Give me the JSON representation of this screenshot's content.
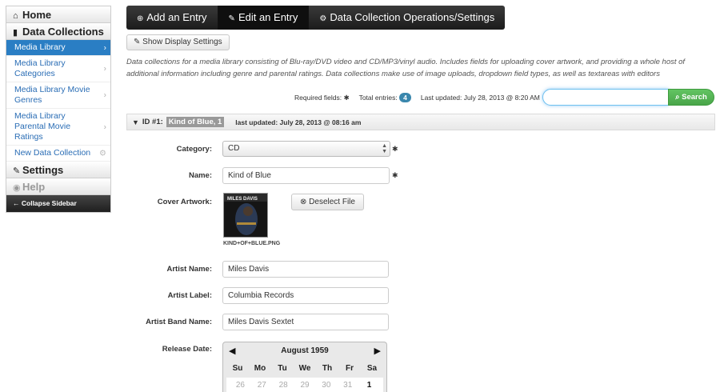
{
  "sidebar": {
    "home": "Home",
    "collections_header": "Data Collections",
    "items": [
      {
        "label": "Media Library"
      },
      {
        "label": "Media Library Categories"
      },
      {
        "label": "Media Library Movie Genres"
      },
      {
        "label": "Media Library Parental Movie Ratings"
      },
      {
        "label": "New Data Collection"
      }
    ],
    "settings": "Settings",
    "help": "Help",
    "collapse": "Collapse Sidebar"
  },
  "topnav": {
    "tabs": [
      {
        "label": "Add an Entry"
      },
      {
        "label": "Edit an Entry"
      },
      {
        "label": "Data Collection Operations/Settings"
      }
    ]
  },
  "toolbar": {
    "show_display": "Show Display Settings"
  },
  "description": "Data collections for a media library consisting of Blu-ray/DVD video and CD/MP3/vinyl audio. Includes fields for uploading cover artwork, and providing a whole host of additional information including genre and parental ratings. Data collections make use of image uploads, dropdown field types, as well as textareas with editors",
  "status": {
    "required_label": "Required fields:",
    "required_mark": "✱",
    "total_label": "Total entries:",
    "total_value": "4",
    "updated": "Last updated: July 28, 2013 @ 8:20 AM"
  },
  "search": {
    "value": "",
    "button": "Search"
  },
  "entry": {
    "id": "ID #1:",
    "name": "Kind of Blue, 1",
    "updated": "last updated: July 28, 2013 @ 08:16 am"
  },
  "form": {
    "category_label": "Category:",
    "category_value": "CD",
    "name_label": "Name:",
    "name_value": "Kind of Blue",
    "cover_label": "Cover Artwork:",
    "cover_art_text": "MILES DAVIS",
    "cover_filename": "KIND+OF+BLUE.PNG",
    "deselect": "Deselect File",
    "artist_name_label": "Artist Name:",
    "artist_name_value": "Miles Davis",
    "artist_label_label": "Artist Label:",
    "artist_label_value": "Columbia Records",
    "band_label": "Artist Band Name:",
    "band_value": "Miles Davis Sextet",
    "release_label": "Release Date:"
  },
  "calendar": {
    "month": "August 1959",
    "dow": [
      "Su",
      "Mo",
      "Tu",
      "We",
      "Th",
      "Fr",
      "Sa"
    ],
    "first_row": [
      "26",
      "27",
      "28",
      "29",
      "30",
      "31",
      "1"
    ]
  }
}
